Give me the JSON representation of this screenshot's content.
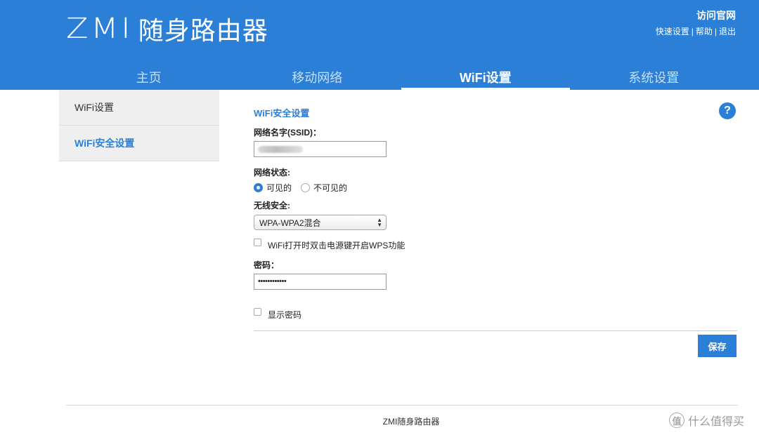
{
  "brand": {
    "logo_prefix": "ZMI",
    "logo_title": "随身路由器"
  },
  "header": {
    "visit_site": "访问官网",
    "links": [
      "快速设置",
      "帮助",
      "退出"
    ],
    "separator": "|"
  },
  "nav": {
    "tabs": [
      {
        "label": "主页",
        "active": false
      },
      {
        "label": "移动网络",
        "active": false
      },
      {
        "label": "WiFi设置",
        "active": true
      },
      {
        "label": "系统设置",
        "active": false
      }
    ]
  },
  "sidebar": {
    "items": [
      {
        "label": "WiFi设置",
        "active": false
      },
      {
        "label": "WiFi安全设置",
        "active": true
      }
    ]
  },
  "form": {
    "section_title": "WiFi安全设置",
    "help_icon": "?",
    "ssid_label": "网络名字(SSID)：",
    "ssid_value": "",
    "status_label": "网络状态:",
    "visible_option": "可见的",
    "invisible_option": "不可见的",
    "visible_selected": true,
    "security_label": "无线安全:",
    "security_value": "WPA-WPA2混合",
    "wps_label": "WiFi打开时双击电源键开启WPS功能",
    "wps_checked": false,
    "password_label": "密码：",
    "password_mask": "••••••••••••",
    "show_password_label": "显示密码",
    "show_password_checked": false,
    "save_label": "保存"
  },
  "footer": {
    "text": "ZMI随身路由器"
  },
  "watermark": {
    "badge": "值",
    "text": "什么值得买"
  },
  "colors": {
    "primary": "#2b7fd6",
    "sidebar_bg": "#efefef"
  }
}
